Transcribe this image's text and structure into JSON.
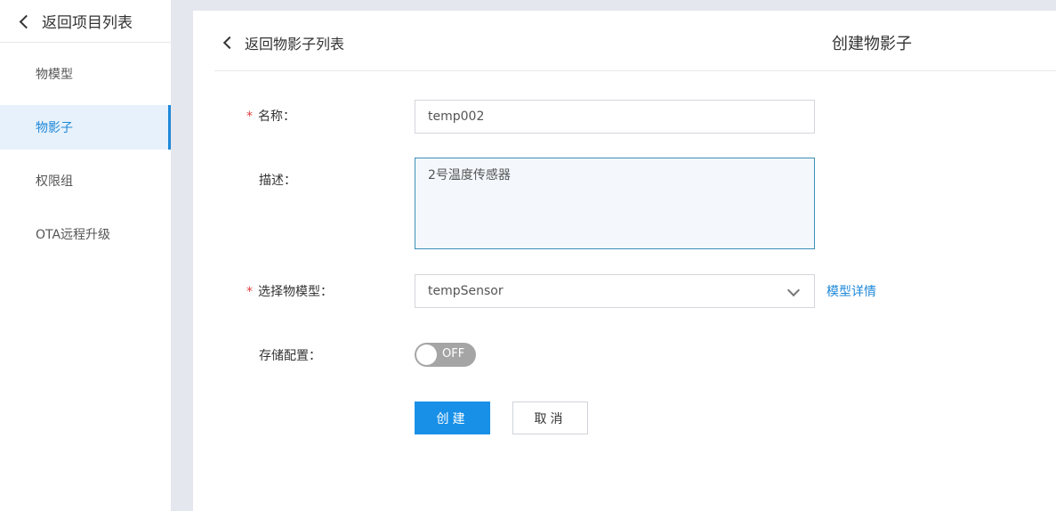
{
  "sidebar": {
    "back_label": "返回项目列表",
    "items": [
      {
        "label": "物模型"
      },
      {
        "label": "物影子"
      },
      {
        "label": "权限组"
      },
      {
        "label": "OTA远程升级"
      }
    ],
    "active_index": 1
  },
  "header": {
    "back_label": "返回物影子列表",
    "title": "创建物影子"
  },
  "form": {
    "name": {
      "label": "名称：",
      "value": "temp002",
      "required": true
    },
    "description": {
      "label": "描述：",
      "value": "2号温度传感器"
    },
    "model": {
      "label": "选择物模型：",
      "value": "tempSensor",
      "required": true,
      "detail_link": "模型详情"
    },
    "storage": {
      "label": "存储配置：",
      "toggle_text": "OFF",
      "enabled": false
    },
    "required_mark": "*"
  },
  "actions": {
    "create_label": "创建",
    "cancel_label": "取消"
  },
  "colors": {
    "accent": "#1e88d8",
    "primary_button": "#1890e8",
    "required": "#e03d3d",
    "toggle_off": "#a5a5a5"
  }
}
